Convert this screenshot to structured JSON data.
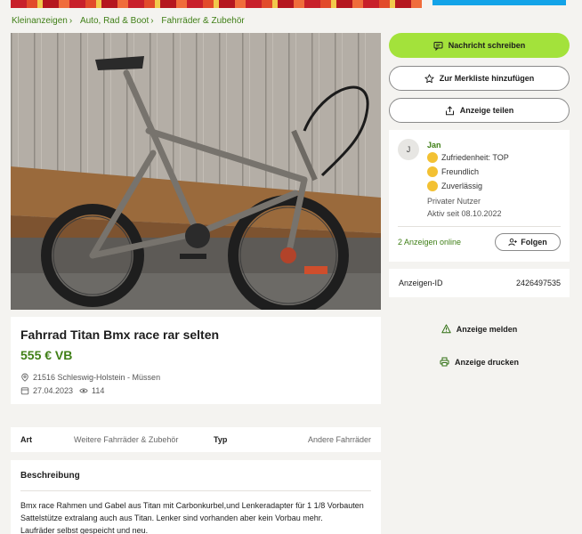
{
  "breadcrumb": [
    "Kleinanzeigen",
    "Auto, Rad & Boot",
    "Fahrräder & Zubehör"
  ],
  "breadcrumb_sep": "›",
  "listing": {
    "title": "Fahrrad Titan Bmx race rar selten",
    "price": "555 € VB",
    "location": "21516 Schleswig-Holstein - Müssen",
    "date": "27.04.2023",
    "views": "114"
  },
  "details": {
    "art_label": "Art",
    "art_value": "Weitere Fahrräder & Zubehör",
    "typ_label": "Typ",
    "typ_value": "Andere Fahrräder"
  },
  "description": {
    "heading": "Beschreibung",
    "lines": [
      "Bmx race Rahmen und Gabel aus Titan mit Carbonkurbel,und Lenkeradapter für 1 1/8 Vorbauten",
      "Sattelstütze extralang auch aus Titan. Lenker sind vorhanden aber kein Vorbau mehr.",
      "Laufräder selbst gespeicht und neu."
    ]
  },
  "actions": {
    "message": "Nachricht schreiben",
    "watchlist": "Zur Merkliste hinzufügen",
    "share": "Anzeige teilen",
    "report": "Anzeige melden",
    "print": "Anzeige drucken"
  },
  "seller": {
    "initial": "J",
    "name": "Jan",
    "badges": [
      "Zufriedenheit: TOP",
      "Freundlich",
      "Zuverlässig"
    ],
    "type": "Privater Nutzer",
    "since": "Aktiv seit 08.10.2022",
    "online_ads": "2 Anzeigen online",
    "follow": "Folgen"
  },
  "ad_id": {
    "label": "Anzeigen-ID",
    "value": "2426497535"
  },
  "colors": {
    "accent_green": "#a3e23b",
    "link_green": "#3f7f16",
    "banner_blue": "#13a3e8"
  },
  "icons": [
    "chat-icon",
    "star-icon",
    "share-icon",
    "location-pin-icon",
    "calendar-icon",
    "eye-icon",
    "follow-icon",
    "warning-icon",
    "printer-icon"
  ]
}
